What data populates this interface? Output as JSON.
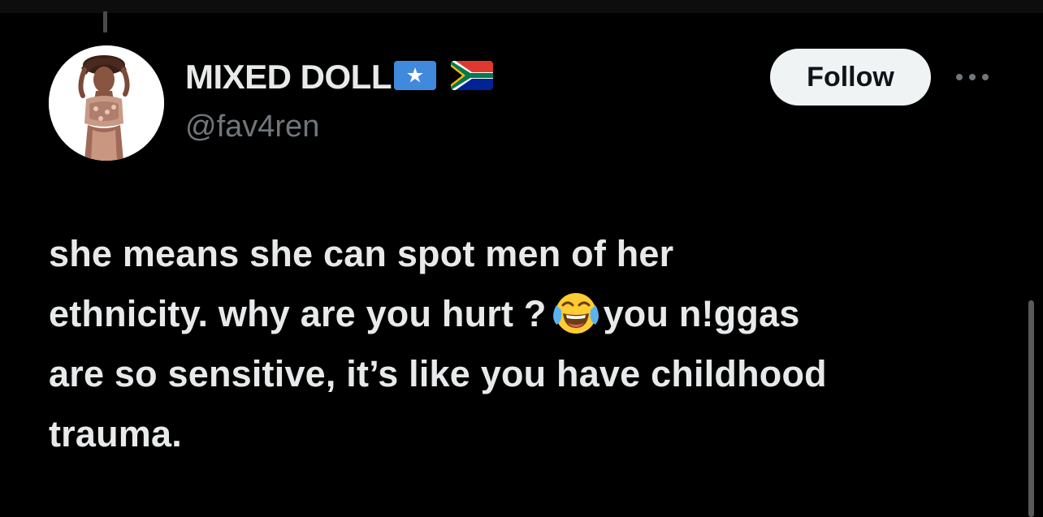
{
  "post": {
    "author": {
      "display_name": "MIXED DOLL",
      "handle": "@fav4ren",
      "flags": [
        "somalia-flag",
        "south-africa-flag"
      ],
      "avatar": "avatar-photo"
    },
    "follow_label": "Follow",
    "more_icon": "more-icon",
    "text_lines": [
      "she means she can spot men of her",
      "ethnicity. why are you hurt ?",
      "you n!ggas",
      "are so sensitive, it’s like you have childhood",
      "trauma."
    ],
    "emoji": "face-with-tears-of-joy"
  },
  "colors": {
    "background": "#000000",
    "text_primary": "#e7e9ea",
    "text_secondary": "#71767b",
    "button_bg": "#eff3f4",
    "button_text": "#0f1419"
  }
}
